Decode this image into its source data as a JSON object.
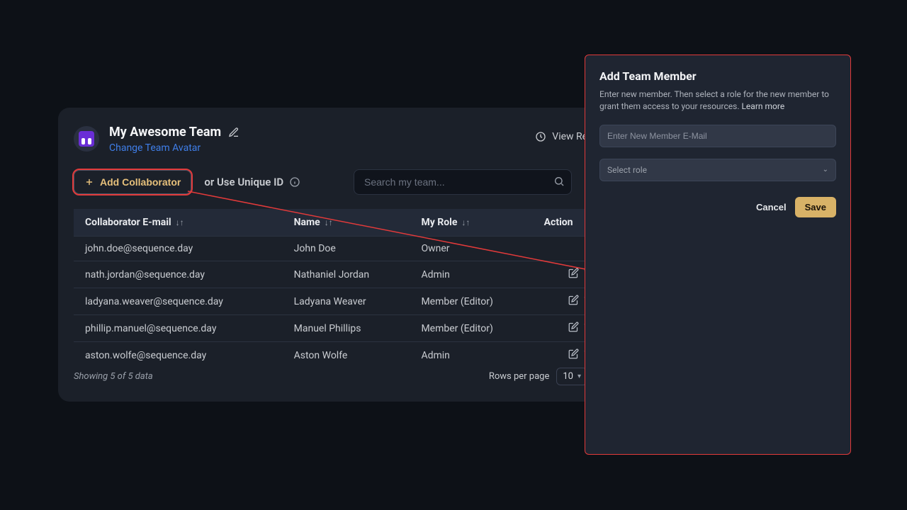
{
  "colors": {
    "accent": "#d8b267",
    "highlight": "#e23a3a",
    "link": "#3f7ee8"
  },
  "team": {
    "title": "My Awesome Team",
    "change_avatar": "Change Team Avatar"
  },
  "header": {
    "view_log": "View Request L"
  },
  "toolbar": {
    "add_collab": "Add Collaborator",
    "or_unique": "or Use Unique ID",
    "search_placeholder": "Search my team..."
  },
  "table": {
    "headers": {
      "email": "Collaborator E-mail",
      "name": "Name",
      "role": "My Role",
      "action": "Action"
    },
    "rows": [
      {
        "email": "john.doe@sequence.day",
        "name": "John Doe",
        "role": "Owner",
        "actions": false
      },
      {
        "email": "nath.jordan@sequence.day",
        "name": "Nathaniel Jordan",
        "role": "Admin",
        "actions": true
      },
      {
        "email": "ladyana.weaver@sequence.day",
        "name": "Ladyana Weaver",
        "role": "Member (Editor)",
        "actions": true
      },
      {
        "email": "phillip.manuel@sequence.day",
        "name": "Manuel Phillips",
        "role": "Member (Editor)",
        "actions": true
      },
      {
        "email": "aston.wolfe@sequence.day",
        "name": "Aston Wolfe",
        "role": "Admin",
        "actions": true
      }
    ]
  },
  "footer": {
    "showing": "Showing 5 of 5 data",
    "rows_label": "Rows per page",
    "rows_value": "10"
  },
  "dialog": {
    "title": "Add Team Member",
    "desc": "Enter new member. Then select a role for the new member to grant them access to your resources. ",
    "learn": "Learn more",
    "email_placeholder": "Enter New Member E-Mail",
    "role_placeholder": "Select role",
    "cancel": "Cancel",
    "save": "Save"
  }
}
